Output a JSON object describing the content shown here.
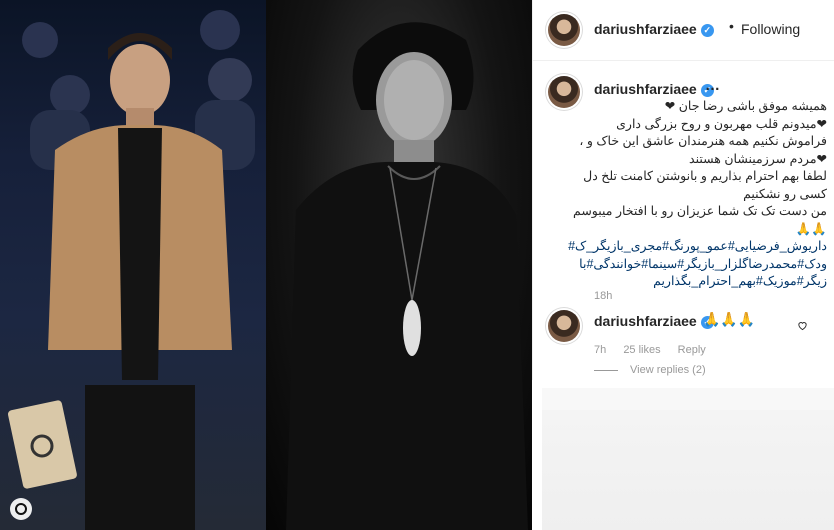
{
  "post": {
    "username": "dariushfarziaee",
    "follow_state": "Following",
    "separator": "•",
    "caption": {
      "more": "…",
      "lines": [
        "همیشه موفق باشی رضا جان ❤",
        "❤میدونم قلب مهربون و روح بزرگی داری",
        "فراموش نکنیم همه هنرمندان عاشق این خاک و ،",
        "❤مردم سرزمینشان هستند",
        "لطفا بهم احترام بذاریم و بانوشتن کامنت تلخ دل",
        "کسی رو نشکنیم",
        "من دست تک تک شما عزیزان رو با افتخار میبوسم",
        "🙏🙏"
      ],
      "hashtags": [
        "داریوش_فرضیایی#عمو_پورنگ#مجری_بازیگر_ک#",
        "ودک#محمدرضاگلزار_بازیگر#سینما#خوانندگی#با",
        "زیگر#موزیک#بهم_احترام_بگذاریم"
      ],
      "time_ago": "18h"
    },
    "comment": {
      "username": "dariushfarziaee",
      "text": "🙏🙏🙏",
      "time": "7h",
      "likes": "25 likes",
      "reply": "Reply",
      "view_replies": "View replies (2)"
    }
  },
  "colors": {
    "verified": "#3897f0",
    "hashtag": "#003569",
    "muted": "#999999"
  },
  "icons": {
    "verified": "verified-badge-icon",
    "like": "heart-outline-icon",
    "carousel": "carousel-indicator-icon"
  }
}
